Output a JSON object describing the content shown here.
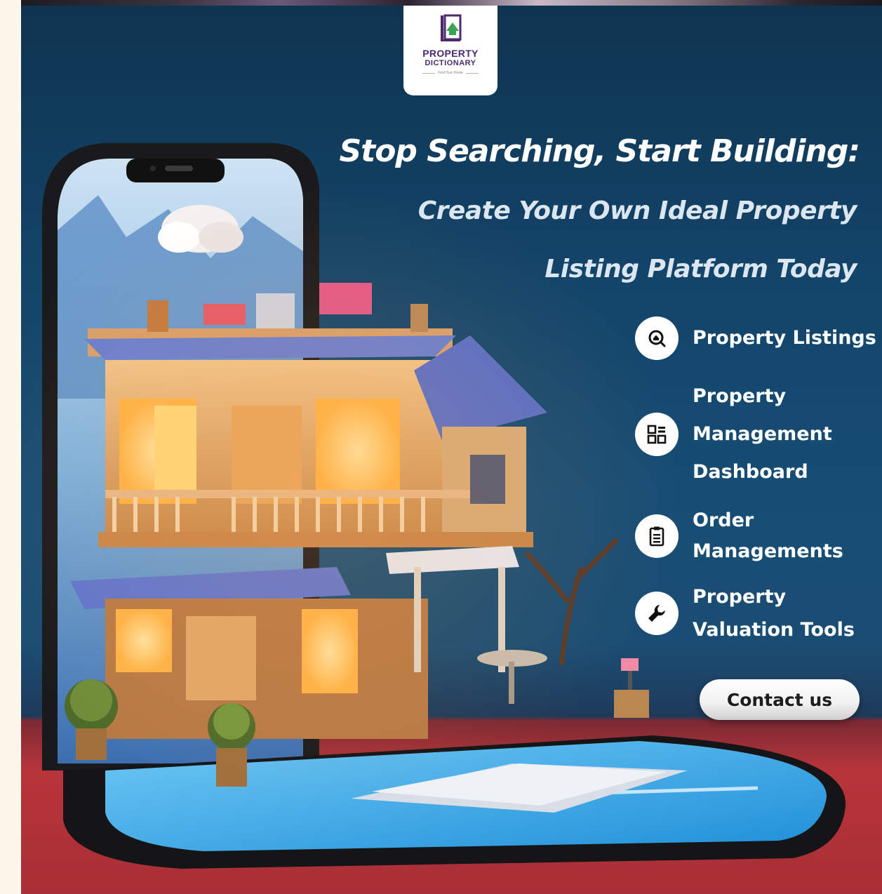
{
  "brand": {
    "name_line1": "PROPERTY",
    "name_line2": "DICTIONARY",
    "tagline": "Find Your Home",
    "logo_icon": "book-house-icon",
    "colors": {
      "primary": "#4b2a6e",
      "accent": "#3aa655"
    }
  },
  "headline": "Stop Searching, Start Building:",
  "subheadline": {
    "line1": "Create Your Own Ideal Property",
    "line2": "Listing Platform Today"
  },
  "features": [
    {
      "icon": "search-home-icon",
      "lines": [
        "Property Listings"
      ]
    },
    {
      "icon": "dashboard-grid-icon",
      "lines": [
        "Property",
        "Management",
        "Dashboard"
      ]
    },
    {
      "icon": "clipboard-list-icon",
      "lines": [
        "Order",
        "Managements"
      ]
    },
    {
      "icon": "wrench-icon",
      "lines": [
        "Property",
        "Valuation Tools"
      ]
    }
  ],
  "cta": {
    "label": "Contact us"
  },
  "colors": {
    "background_top": "#0f3450",
    "background_mid": "#174d75",
    "floor": "#b7343a",
    "text": "#ffffff"
  }
}
